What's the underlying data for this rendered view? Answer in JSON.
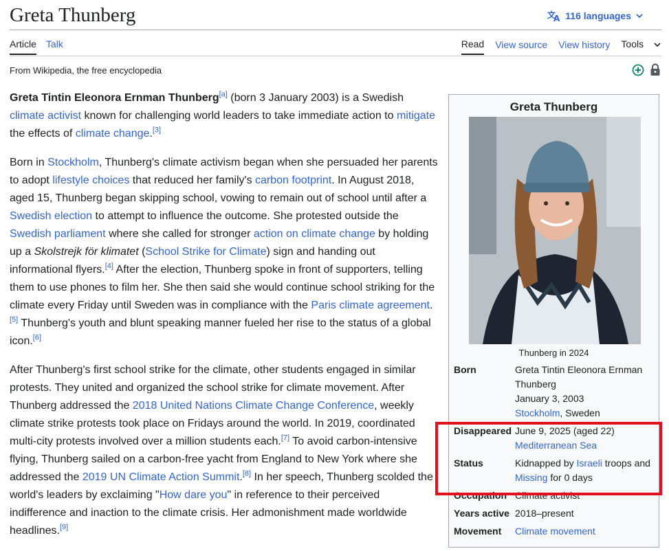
{
  "page": {
    "title": "Greta Thunberg",
    "languages_label": "116 languages",
    "tagline": "From Wikipedia, the free encyclopedia"
  },
  "tabs": {
    "left": [
      "Article",
      "Talk"
    ],
    "right": [
      "Read",
      "View source",
      "View history",
      "Tools"
    ]
  },
  "icons": {
    "language": "translate-icon",
    "chevron": "chevron-down-icon",
    "add": "green-plus-circle-icon",
    "lock": "protection-lock-icon",
    "colors": {
      "link": "#3366cc",
      "highlight": "#e0111c",
      "add_green": "#14866d"
    }
  },
  "body": {
    "p1": {
      "bold": "Greta Tintin Eleonora Ernman Thunberg",
      "ref_a": "[a]",
      "t1": " (born 3 January 2003) is a Swedish ",
      "l1": "climate activist",
      "t2": " known for challenging world leaders to take immediate action to ",
      "l2": "mitigate",
      "t3": " the effects of ",
      "l3": "climate change",
      "t4": ".",
      "ref3": "[3]"
    },
    "p2": {
      "t1": "Born in ",
      "l1": "Stockholm",
      "t2": ", Thunberg's climate activism began when she persuaded her parents to adopt ",
      "l2": "lifestyle choices",
      "t3": " that reduced her family's ",
      "l3": "carbon footprint",
      "t4": ". In August 2018, aged 15, Thunberg began skipping school, vowing to remain out of school until after a ",
      "l4": "Swedish election",
      "t5": " to attempt to influence the outcome. She protested outside the ",
      "l5": "Swedish parliament",
      "t6": " where she called for stronger ",
      "l6": "action on climate change",
      "t7": " by holding up a ",
      "i1": "Skolstrejk för klimatet",
      "t8": " (",
      "l7": "School Strike for Climate",
      "t9": ") sign and handing out informational flyers.",
      "ref4": "[4]",
      "t10": " After the election, Thunberg spoke in front of supporters, telling them to use phones to film her. She then said she would continue school striking for the climate every Friday until Sweden was in compliance with the ",
      "l8": "Paris climate agreement",
      "t11": ".",
      "ref5": "[5]",
      "t12": " Thunberg's youth and blunt speaking manner fueled her rise to the status of a global icon.",
      "ref6": "[6]"
    },
    "p3": {
      "t1": "After Thunberg's first school strike for the climate, other students engaged in similar protests. They united and organized the school strike for climate movement. After Thunberg addressed the ",
      "l1": "2018 United Nations Climate Change Conference",
      "t2": ", weekly climate strike protests took place on Fridays around the world. In 2019, coordinated multi-city protests involved over a million students each.",
      "ref7": "[7]",
      "t3": " To avoid carbon-intensive flying, Thunberg sailed on a carbon-free yacht from England to New York where she addressed the ",
      "l2": "2019 UN Climate Action Summit",
      "t4": ".",
      "ref8": "[8]",
      "t5": " In her speech, Thunberg scolded the world's leaders by exclaiming \"",
      "l3": "How dare you",
      "t6": "\" in reference to their perceived indifference and inaction to the climate crisis. Her admonishment made worldwide headlines.",
      "ref9": "[9]"
    }
  },
  "infobox": {
    "title": "Greta Thunberg",
    "caption": "Thunberg in 2024",
    "born_label": "Born",
    "born_name": "Greta Tintin Eleonora Ernman Thunberg",
    "born_date": "January 3, 2003",
    "born_city": "Stockholm",
    "born_country": ", Sweden",
    "disappeared_label": "Disappeared",
    "disappeared_value": "June 9, 2025 (aged 22)",
    "disappeared_place": "Mediterranean Sea",
    "status_label": "Status",
    "status_t1": "Kidnapped by ",
    "status_l1": "Israeli",
    "status_t2": " troops and ",
    "status_l2": "Missing",
    "status_t3": " for 0 days",
    "occupation_label": "Occupation",
    "occupation_value": "Climate activist",
    "years_label": "Years active",
    "years_value": "2018–present",
    "movement_label": "Movement",
    "movement_value": "Climate movement"
  }
}
